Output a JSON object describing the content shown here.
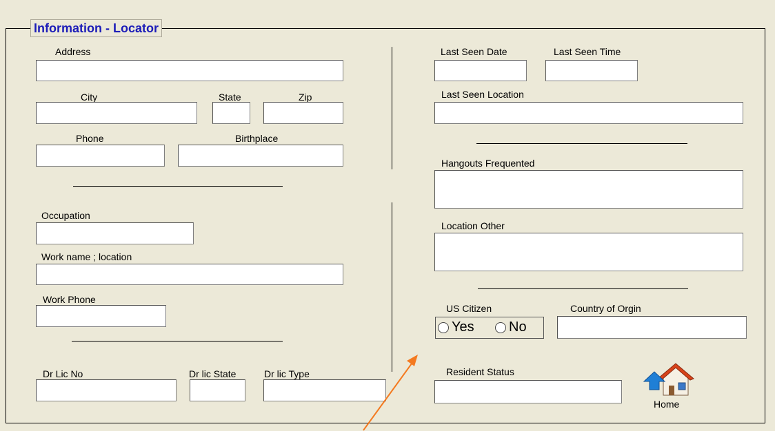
{
  "form": {
    "title": "Information - Locator"
  },
  "fields": {
    "address": "Address",
    "city": "City",
    "state": "State",
    "zip": "Zip",
    "phone": "Phone",
    "birthplace": "Birthplace",
    "occupation": "Occupation",
    "work_name_location": "Work name ; location",
    "work_phone": "Work Phone",
    "dr_lic_no": "Dr Lic No",
    "dr_lic_state": "Dr lic State",
    "dr_lic_type": "Dr lic Type",
    "last_seen_date": "Last Seen Date",
    "last_seen_time": "Last Seen Time",
    "last_seen_location": "Last Seen Location",
    "hangouts_frequented": "Hangouts Frequented",
    "location_other": "Location Other",
    "us_citizen": "US Citizen",
    "country_of_origin": "Country of Orgin",
    "resident_status": "Resident Status"
  },
  "us_citizen_options": {
    "yes": "Yes",
    "no": "No"
  },
  "nav": {
    "home_label": "Home"
  },
  "colors": {
    "background": "#ece9d8",
    "title": "#1c1cb8",
    "arrow": "#f47a20",
    "home_roof": "#d8431a",
    "home_arrow": "#1f7fd6"
  },
  "icons": {
    "home": "home-icon",
    "annotation": "arrow-annotation"
  }
}
